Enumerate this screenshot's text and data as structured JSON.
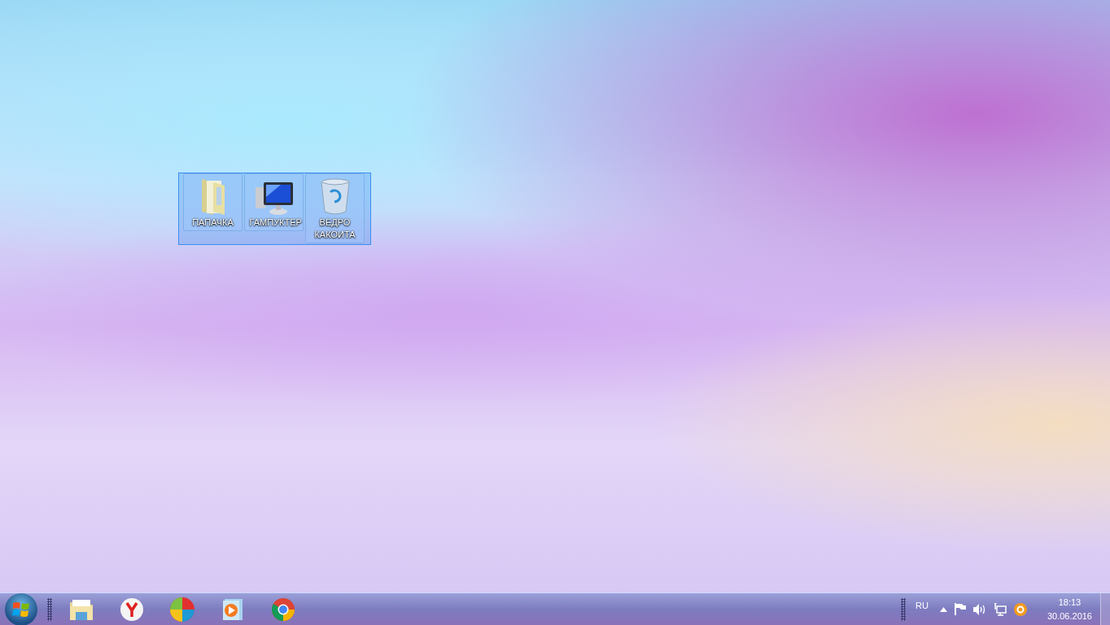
{
  "desktop_icons": [
    {
      "label": "ПАПАЧКА",
      "kind": "folder",
      "selected": true
    },
    {
      "label": "ГАМПУКТЕР",
      "kind": "computer",
      "selected": true
    },
    {
      "label": "ВЕДРО КАКОИТА",
      "kind": "bin",
      "selected": true
    }
  ],
  "taskbar": {
    "language": "RU",
    "time": "18:13",
    "date": "30.06.2016"
  }
}
